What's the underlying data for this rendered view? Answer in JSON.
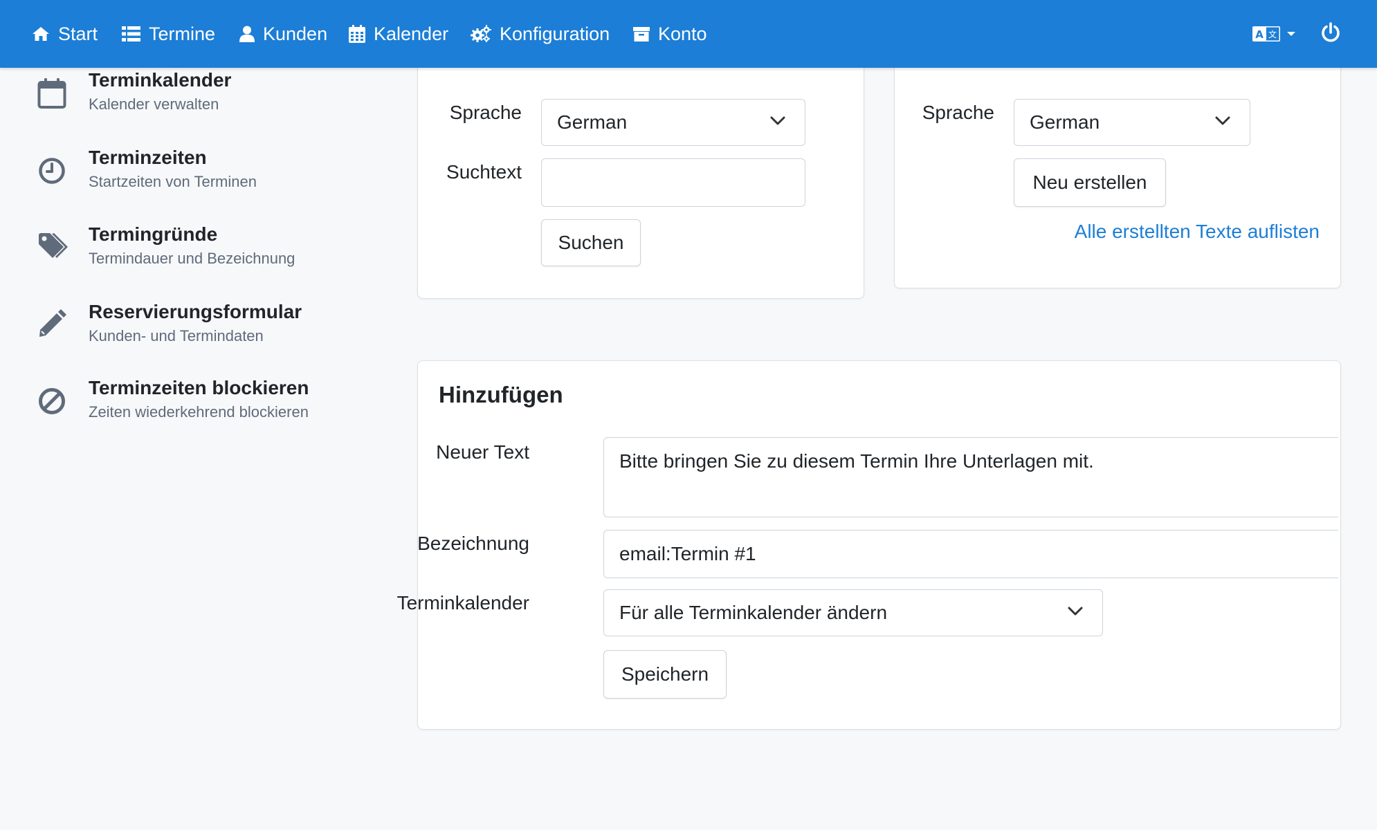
{
  "nav": {
    "items": [
      {
        "label": "Start",
        "icon": "home-icon"
      },
      {
        "label": "Termine",
        "icon": "list-icon"
      },
      {
        "label": "Kunden",
        "icon": "user-icon"
      },
      {
        "label": "Kalender",
        "icon": "calendar-icon"
      },
      {
        "label": "Konfiguration",
        "icon": "cogs-icon"
      },
      {
        "label": "Konto",
        "icon": "archive-icon"
      }
    ],
    "language_icon": "language-icon",
    "power_icon": "power-icon"
  },
  "sidebar": {
    "items": [
      {
        "title": "Terminkalender",
        "subtitle": "Kalender verwalten",
        "icon": "calendar-icon"
      },
      {
        "title": "Terminzeiten",
        "subtitle": "Startzeiten von Terminen",
        "icon": "clock-icon"
      },
      {
        "title": "Termingründe",
        "subtitle": "Termindauer und Bezeichnung",
        "icon": "tags-icon"
      },
      {
        "title": "Reservierungsformular",
        "subtitle": "Kunden- und Termindaten",
        "icon": "pencil-icon"
      },
      {
        "title": "Terminzeiten blockieren",
        "subtitle": "Zeiten wiederkehrend blockieren",
        "icon": "ban-icon"
      }
    ]
  },
  "search_card": {
    "language_label": "Sprache",
    "language_value": "German",
    "search_label": "Suchtext",
    "search_value": "",
    "search_button": "Suchen"
  },
  "create_card": {
    "language_label": "Sprache",
    "language_value": "German",
    "create_button": "Neu erstellen",
    "list_link": "Alle erstellten Texte auflisten"
  },
  "add_card": {
    "title": "Hinzufügen",
    "text_label": "Neuer Text",
    "text_value": "Bitte bringen Sie zu diesem Termin Ihre Unterlagen mit.",
    "name_label": "Bezeichnung",
    "name_value": "email:Termin #1",
    "calendar_label": "Terminkalender",
    "calendar_value": "Für alle Terminkalender ändern",
    "save_button": "Speichern"
  },
  "colors": {
    "navbar": "#1c7ed6",
    "link": "#1c7ed6",
    "background": "#f7f8fa"
  }
}
